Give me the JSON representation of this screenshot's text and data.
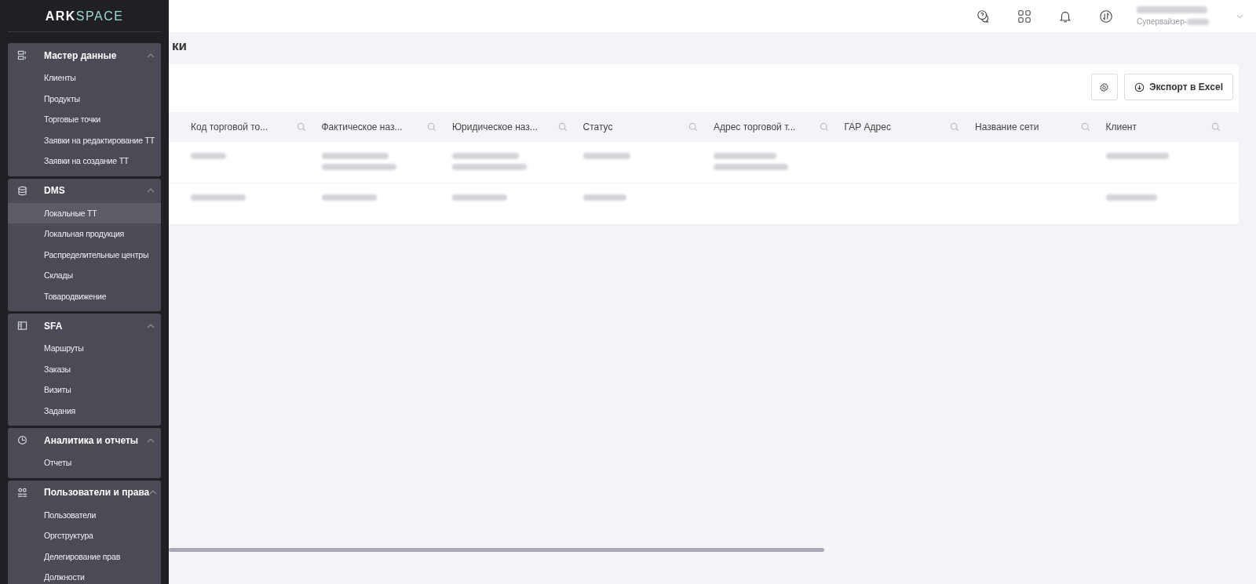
{
  "sidebar": {
    "logo": {
      "part_1": "ARK",
      "part_2": "SPACE"
    },
    "groups": [
      {
        "kind": "master",
        "title": "Мастер данные",
        "expanded": true,
        "items": [
          {
            "label": "Клиенты",
            "selected": false
          },
          {
            "label": "Продукты",
            "selected": false
          },
          {
            "label": "Торговые точки",
            "selected": false
          },
          {
            "label": "Заявки на редактирование ТТ",
            "selected": false
          },
          {
            "label": "Заявки на создание ТТ",
            "selected": false
          }
        ]
      },
      {
        "kind": "database",
        "title": "DMS",
        "expanded": true,
        "items": [
          {
            "label": "Локальные ТТ",
            "selected": true
          },
          {
            "label": "Локальная продукция",
            "selected": false
          },
          {
            "label": "Распределительные центры",
            "selected": false
          },
          {
            "label": "Склады",
            "selected": false
          },
          {
            "label": "Товародвижение",
            "selected": false
          }
        ]
      },
      {
        "kind": "panel",
        "title": "SFA",
        "expanded": true,
        "items": [
          {
            "label": "Маршруты",
            "selected": false
          },
          {
            "label": "Заказы",
            "selected": false
          },
          {
            "label": "Визиты",
            "selected": false
          },
          {
            "label": "Задания",
            "selected": false
          }
        ]
      },
      {
        "kind": "chart",
        "title": "Аналитика и отчеты",
        "expanded": true,
        "items": [
          {
            "label": "Отчеты",
            "selected": false
          }
        ]
      },
      {
        "kind": "users",
        "title": "Пользователи и права",
        "expanded": true,
        "items": [
          {
            "label": "Пользователи",
            "selected": false
          },
          {
            "label": "Оргструктура",
            "selected": false
          },
          {
            "label": "Делегирование прав",
            "selected": false
          },
          {
            "label": "Должности",
            "selected": false
          }
        ]
      }
    ]
  },
  "header": {
    "user_role": "Супервайзер-"
  },
  "page": {
    "title": "ки"
  },
  "toolbar": {
    "export_button": "Экспорт в Excel"
  },
  "table": {
    "columns": [
      "Код торговой то...",
      "Фактическое наз...",
      "Юридическое наз...",
      "Статус",
      "Адрес торговой т...",
      "ГАР Адрес",
      "Название сети",
      "Клиент"
    ]
  }
}
